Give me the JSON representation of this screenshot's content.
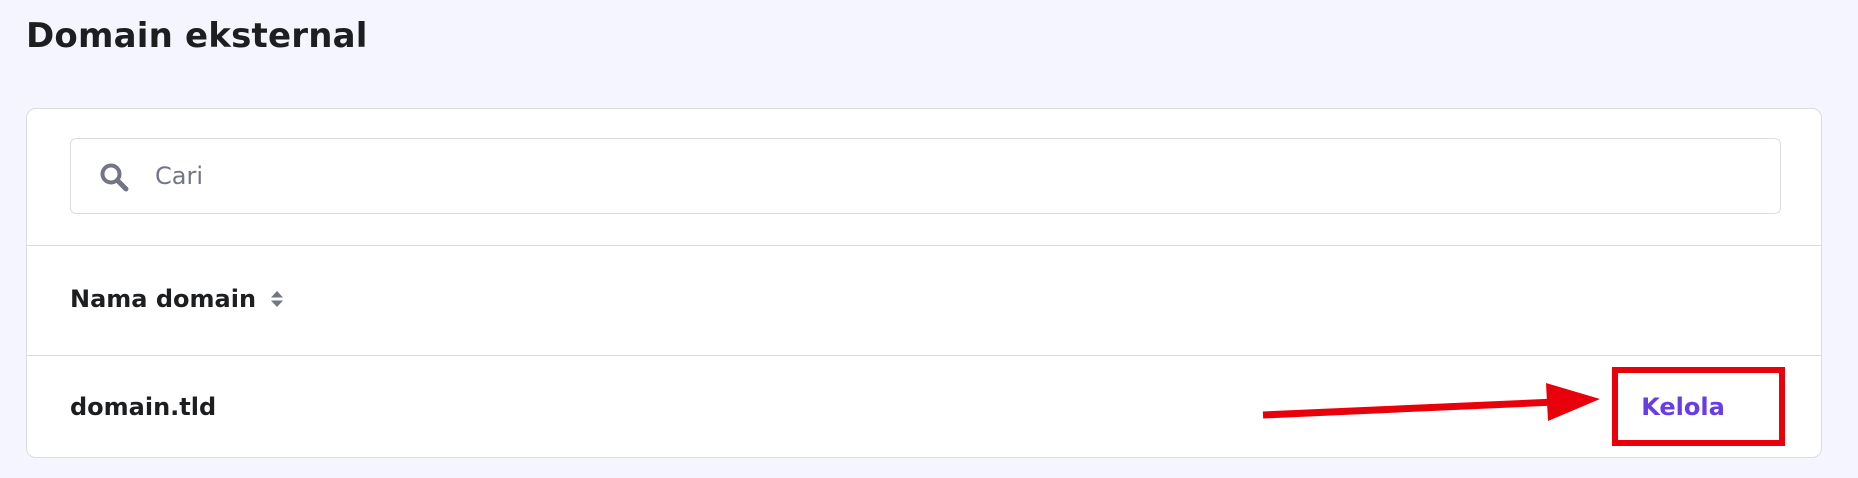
{
  "header": {
    "title": "Domain eksternal"
  },
  "search": {
    "placeholder": "Cari",
    "value": "",
    "icon": "search-icon"
  },
  "table": {
    "columns": [
      {
        "label": "Nama domain",
        "sortable": true,
        "sort_icon": "sort-icon"
      }
    ],
    "rows": [
      {
        "domain": "domain.tld",
        "action_label": "Kelola"
      }
    ]
  },
  "annotation": {
    "highlight_color": "#e8000b"
  },
  "colors": {
    "background": "#f4f5ff",
    "accent": "#673de6",
    "text": "#1d1e20",
    "muted": "#727586",
    "border": "#dadce0"
  }
}
